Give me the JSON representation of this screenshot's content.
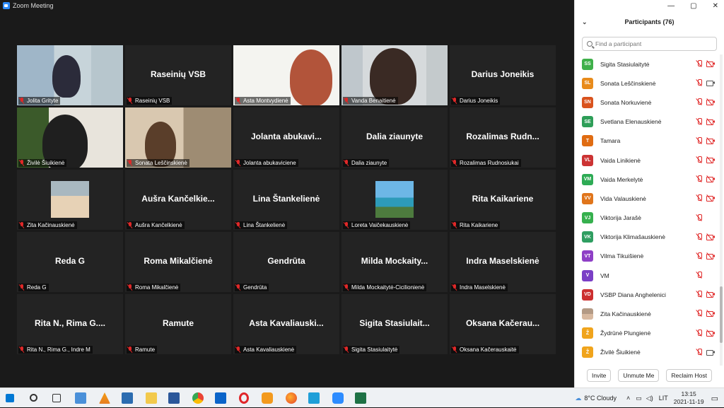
{
  "window": {
    "title": "Zoom Meeting"
  },
  "gallery": {
    "tiles": [
      {
        "bigname": "",
        "label": "Jolita Grityte",
        "video": "jolita"
      },
      {
        "bigname": "Raseinių VSB",
        "label": "Raseinių VSB"
      },
      {
        "bigname": "",
        "label": "Asta Montvydienė",
        "video": "asta"
      },
      {
        "bigname": "",
        "label": "Vanda Benaitienė",
        "video": "vanda",
        "active": true
      },
      {
        "bigname": "Darius Joneikis",
        "label": "Darius Joneikis"
      },
      {
        "bigname": "",
        "label": "Živilė Šiuikienė",
        "video": "zivile"
      },
      {
        "bigname": "",
        "label": "Sonata Leščinskienė",
        "video": "sonata"
      },
      {
        "bigname": "Jolanta abukavi...",
        "label": "Jolanta abukaviciene"
      },
      {
        "bigname": "Dalia ziaunyte",
        "label": "Dalia ziaunyte"
      },
      {
        "bigname": "Rozalimas Rudn...",
        "label": "Rozalimas Rudnosiukai"
      },
      {
        "bigname": "",
        "label": "Zita Kačinauskienė",
        "thumb": "zita"
      },
      {
        "bigname": "Aušra Kančelkie...",
        "label": "Aušra Kančelkienė"
      },
      {
        "bigname": "Lina Štankelienė",
        "label": "Lina Štankelienė"
      },
      {
        "bigname": "",
        "label": "Loreta Vaičekauskienė",
        "thumb": "loreta"
      },
      {
        "bigname": "Rita Kaikariene",
        "label": "Rita Kaikariene"
      },
      {
        "bigname": "Reda G",
        "label": "Reda G"
      },
      {
        "bigname": "Roma Mikalčienė",
        "label": "Roma Mikalčienė"
      },
      {
        "bigname": "Gendrūta",
        "label": "Gendrūta"
      },
      {
        "bigname": "Milda Mockaity...",
        "label": "Milda Mockaitytė-Cicilionienė"
      },
      {
        "bigname": "Indra Maselskienė",
        "label": "Indra Maselskienė"
      },
      {
        "bigname": "Rita N., Rima G....",
        "label": "Rita N., Rima G., Indre M"
      },
      {
        "bigname": "Ramute",
        "label": "Ramute"
      },
      {
        "bigname": "Asta Kavaliauski...",
        "label": "Asta Kavaliauskienė"
      },
      {
        "bigname": "Sigita Stasiulait...",
        "label": "Sigita Stasiulaitytė"
      },
      {
        "bigname": "Oksana Kačerau...",
        "label": "Oksana Kačerauskaitė"
      }
    ]
  },
  "participants": {
    "header": "Participants (76)",
    "search_placeholder": "Find a participant",
    "list": [
      {
        "initials": "SS",
        "name": "Sigita Stasiulaitytė",
        "color": "#3fb04a",
        "cam": "off"
      },
      {
        "initials": "SL",
        "name": "Sonata Leščinskienė",
        "color": "#e88b1b",
        "cam": "on"
      },
      {
        "initials": "SN",
        "name": "Sonata Norkuvienė",
        "color": "#d9531e",
        "cam": "off"
      },
      {
        "initials": "SE",
        "name": "Svetlana Elenauskienė",
        "color": "#2e9e58",
        "cam": "off"
      },
      {
        "initials": "T",
        "name": "Tamara",
        "color": "#e06c12",
        "cam": "off"
      },
      {
        "initials": "VL",
        "name": "Vaida Linikienė",
        "color": "#cc3333",
        "cam": "off"
      },
      {
        "initials": "VM",
        "name": "Vaida Merkelytė",
        "color": "#2eab55",
        "cam": "off"
      },
      {
        "initials": "VV",
        "name": "Vida Valauskienė",
        "color": "#e0751b",
        "cam": "off"
      },
      {
        "initials": "VJ",
        "name": "Viktorija Jarašė",
        "color": "#36b04e",
        "cam": "none"
      },
      {
        "initials": "VK",
        "name": "Viktorija Klimašauskienė",
        "color": "#2f9e61",
        "cam": "off"
      },
      {
        "initials": "VT",
        "name": "Vilma Tikuišienė",
        "color": "#8e3fc6",
        "cam": "off"
      },
      {
        "initials": "V",
        "name": "VM",
        "color": "#7a3fc6",
        "cam": "none"
      },
      {
        "initials": "VD",
        "name": "VSBP Diana Anghelenici",
        "color": "#cc2f2f",
        "cam": "off"
      },
      {
        "initials": "",
        "name": "Zita Kačinauskienė",
        "color": "photo",
        "cam": "off"
      },
      {
        "initials": "Ž",
        "name": "Žydrūnė Plungienė",
        "color": "#f0a41c",
        "cam": "off"
      },
      {
        "initials": "Ž",
        "name": "Živilė Šiuikienė",
        "color": "#f0a41c",
        "cam": "on"
      }
    ],
    "buttons": {
      "invite": "Invite",
      "unmute_me": "Unmute Me",
      "raise_hand": "Reclaim Host"
    }
  },
  "taskbar": {
    "weather": "8°C  Cloudy",
    "language": "LIT",
    "time": "13:15",
    "date": "2021-11-19"
  },
  "colors": {
    "active_speaker": "#b7e14f",
    "zoom_blue": "#2d8cff",
    "muted_red": "#e02828"
  }
}
